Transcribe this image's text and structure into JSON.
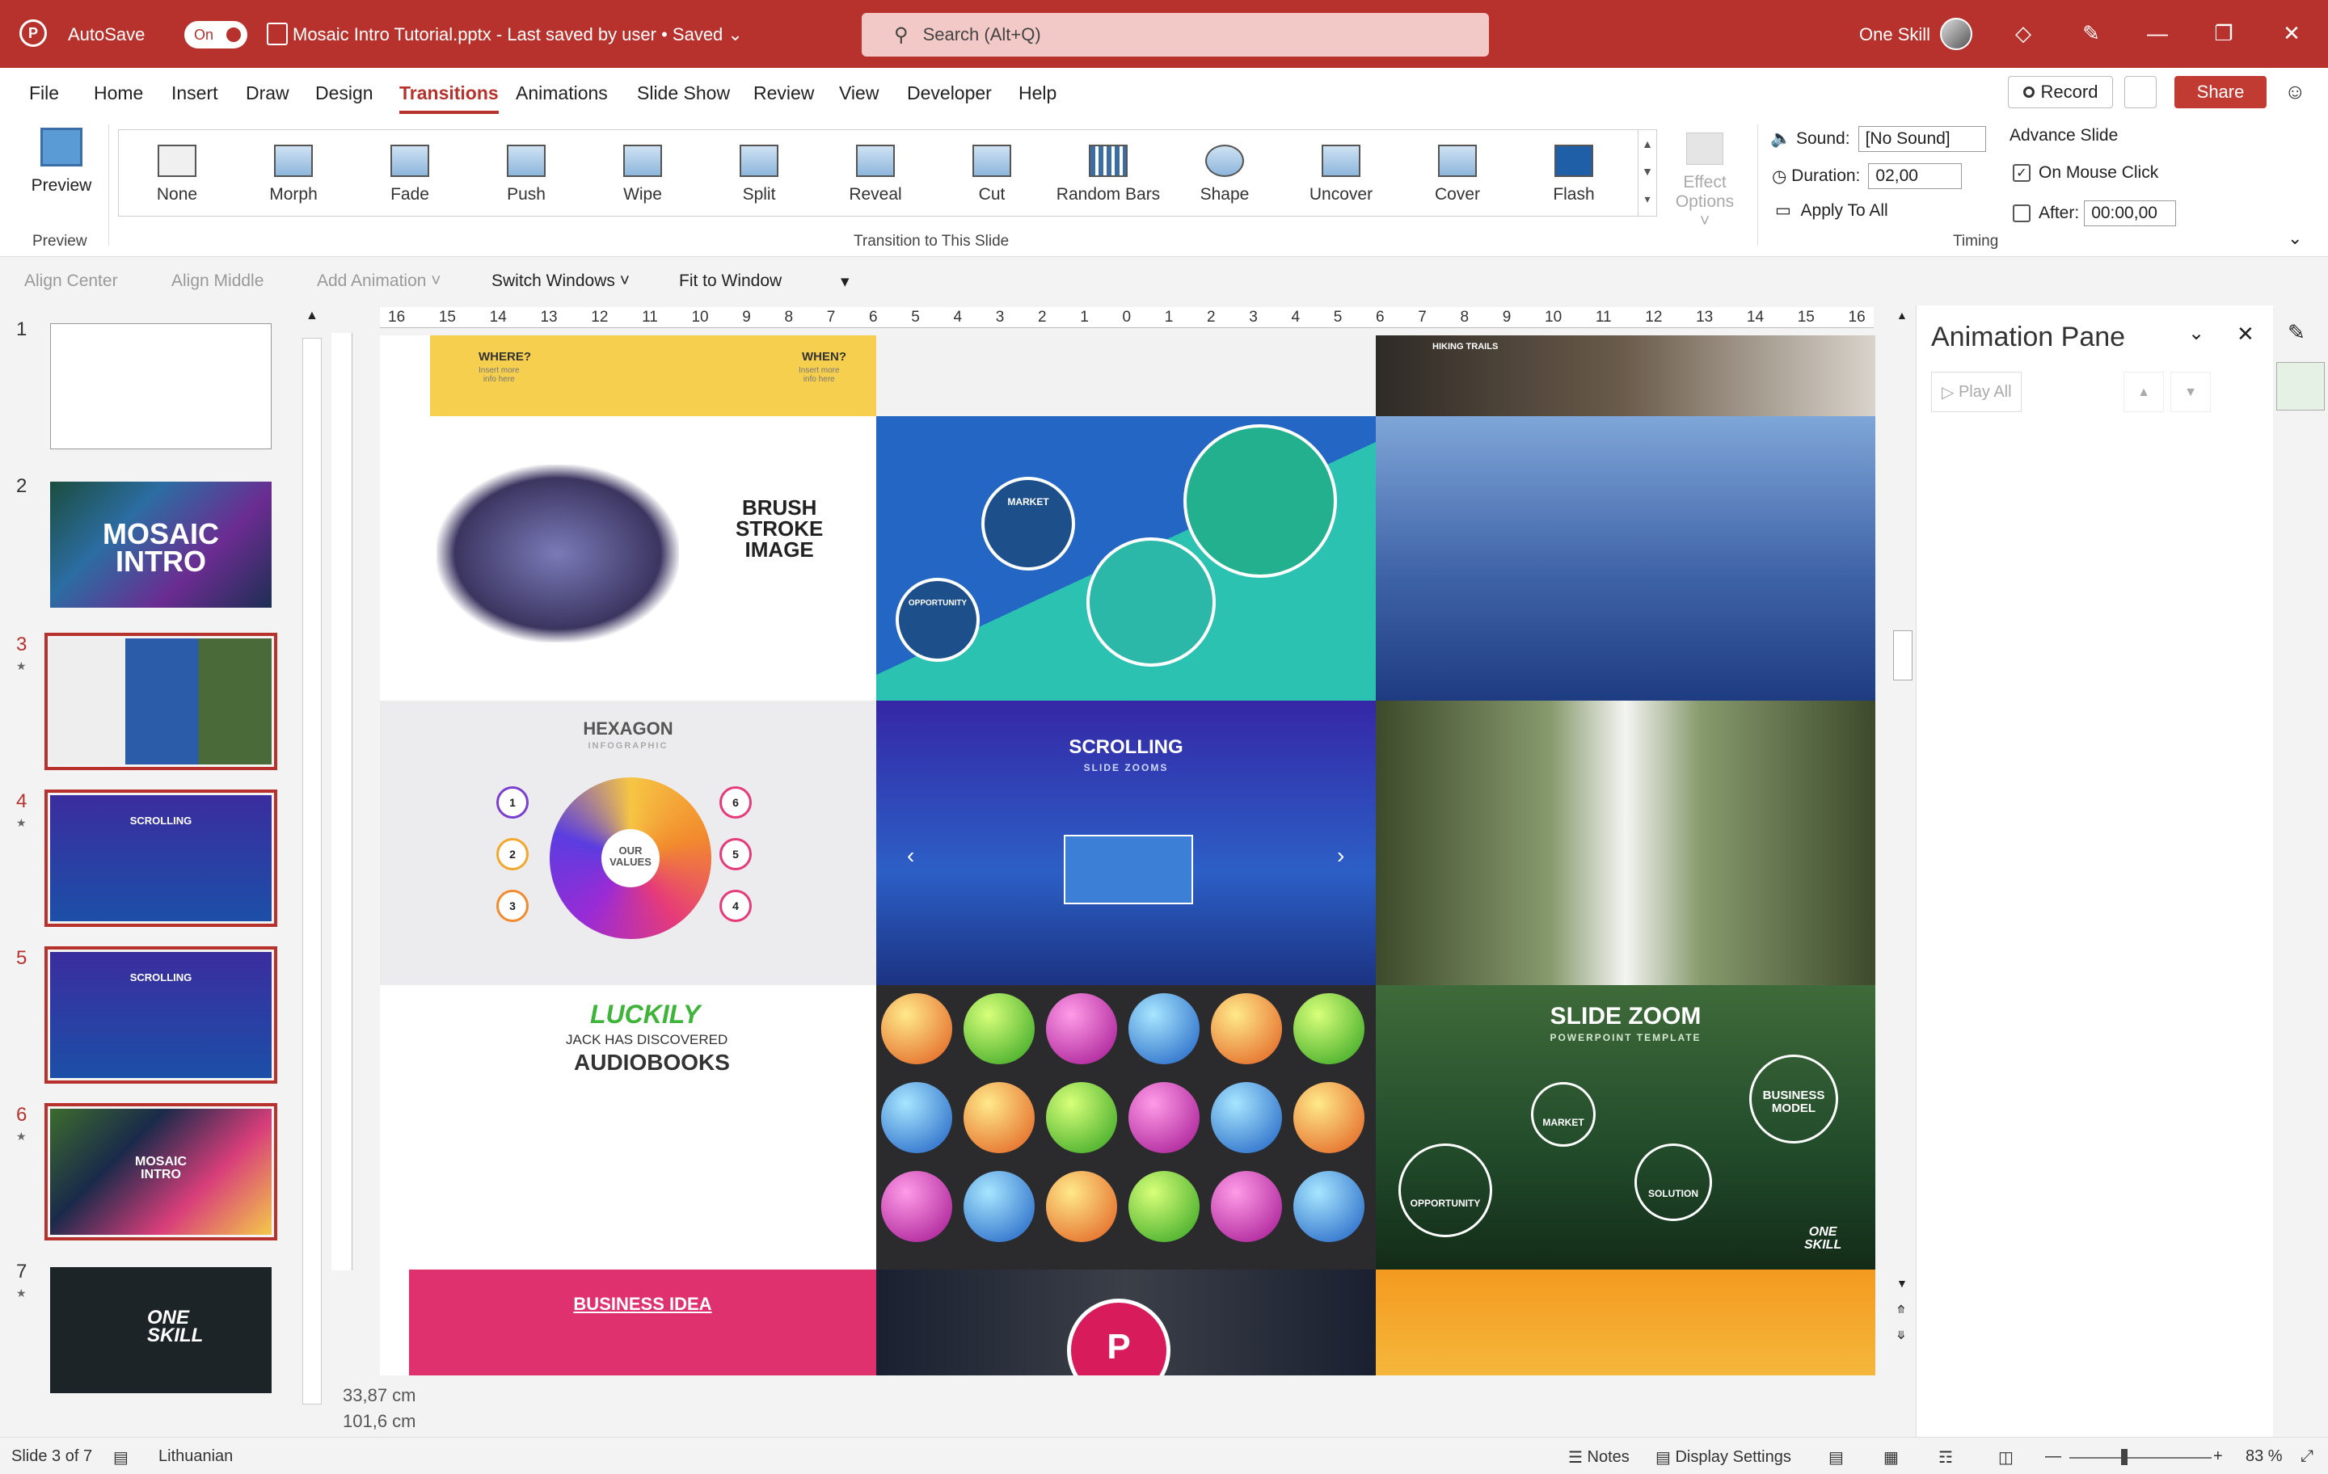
{
  "titlebar": {
    "autosave": "AutoSave",
    "toggle": "On",
    "doc_title": "Mosaic Intro Tutorial.pptx  -  Last saved by user • Saved ⌄",
    "search_placeholder": "Search (Alt+Q)",
    "user": "One Skill"
  },
  "tabs": [
    "File",
    "Home",
    "Insert",
    "Draw",
    "Design",
    "Transitions",
    "Animations",
    "Slide Show",
    "Review",
    "View",
    "Developer",
    "Help"
  ],
  "active_tab": "Transitions",
  "actions": {
    "record": "Record",
    "share": "Share"
  },
  "ribbon": {
    "preview": "Preview",
    "preview_group": "Preview",
    "transitions": [
      "None",
      "Morph",
      "Fade",
      "Push",
      "Wipe",
      "Split",
      "Reveal",
      "Cut",
      "Random Bars",
      "Shape",
      "Uncover",
      "Cover",
      "Flash"
    ],
    "group_label": "Transition to This Slide",
    "effect_options": "Effect\nOptions ˅",
    "sound_label": "Sound:",
    "sound_value": "[No Sound]",
    "duration_label": "Duration:",
    "duration_value": "02,00",
    "apply_all": "Apply To All",
    "advance_title": "Advance Slide",
    "on_click": "On Mouse Click",
    "after_label": "After:",
    "after_value": "00:00,00",
    "timing_group": "Timing"
  },
  "qat": {
    "align_center": "Align Center",
    "align_middle": "Align Middle",
    "add_animation": "Add Animation ˅",
    "switch_windows": "Switch Windows ˅",
    "fit_window": "Fit to Window"
  },
  "slides": [
    {
      "num": "1",
      "star": false
    },
    {
      "num": "2",
      "star": false,
      "title": "MOSAIC\nINTRO"
    },
    {
      "num": "3",
      "star": true,
      "selected": true
    },
    {
      "num": "4",
      "star": true,
      "title": "SCROLLING"
    },
    {
      "num": "5",
      "star": false,
      "title": "SCROLLING"
    },
    {
      "num": "6",
      "star": true,
      "title": "MOSAIC\nINTRO"
    },
    {
      "num": "7",
      "star": true,
      "title": "ONE\nSKILL"
    }
  ],
  "ruler_ticks": [
    "16",
    "15",
    "14",
    "13",
    "12",
    "11",
    "10",
    "9",
    "8",
    "7",
    "6",
    "5",
    "4",
    "3",
    "2",
    "1",
    "0",
    "1",
    "2",
    "3",
    "4",
    "5",
    "6",
    "7",
    "8",
    "9",
    "10",
    "11",
    "12",
    "13",
    "14",
    "15",
    "16"
  ],
  "canvas": {
    "where": "WHERE?",
    "when": "WHEN?",
    "insert_more": "Insert more\ninfo here",
    "hiking": "HIKING TRAILS",
    "brush": "BRUSH\nSTROKE\nIMAGE",
    "market": "MARKET",
    "opportunity": "OPPORTUNITY",
    "hexagon": "HEXAGON",
    "infographic": "INFOGRAPHIC",
    "our_values": "OUR\nVALUES",
    "hex_nums": [
      "1",
      "2",
      "3",
      "6",
      "5",
      "4"
    ],
    "scrolling": "SCROLLING",
    "slide_zooms": "SLIDE ZOOMS",
    "luckily": "LUCKILY",
    "jack": "JACK HAS DISCOVERED",
    "audiobooks": "AUDIOBOOKS",
    "slide_zoom": "SLIDE ZOOM",
    "pp_template": "POWERPOINT TEMPLATE",
    "business_model": "BUSINESS\nMODEL",
    "solution": "SOLUTION",
    "business_idea": "BUSINESS IDEA",
    "p": "P",
    "one_skill": "ONE\nSKILL"
  },
  "notes": {
    "width": "33,87 cm",
    "height": "101,6 cm"
  },
  "anim_pane": {
    "title": "Animation Pane",
    "play_all": "Play All"
  },
  "status": {
    "slide_info": "Slide 3 of 7",
    "language": "Lithuanian",
    "notes": "Notes",
    "display": "Display Settings",
    "zoom": "83 %"
  },
  "colors": {
    "accent": "#b7322c",
    "titlebar": "#b7322c"
  }
}
